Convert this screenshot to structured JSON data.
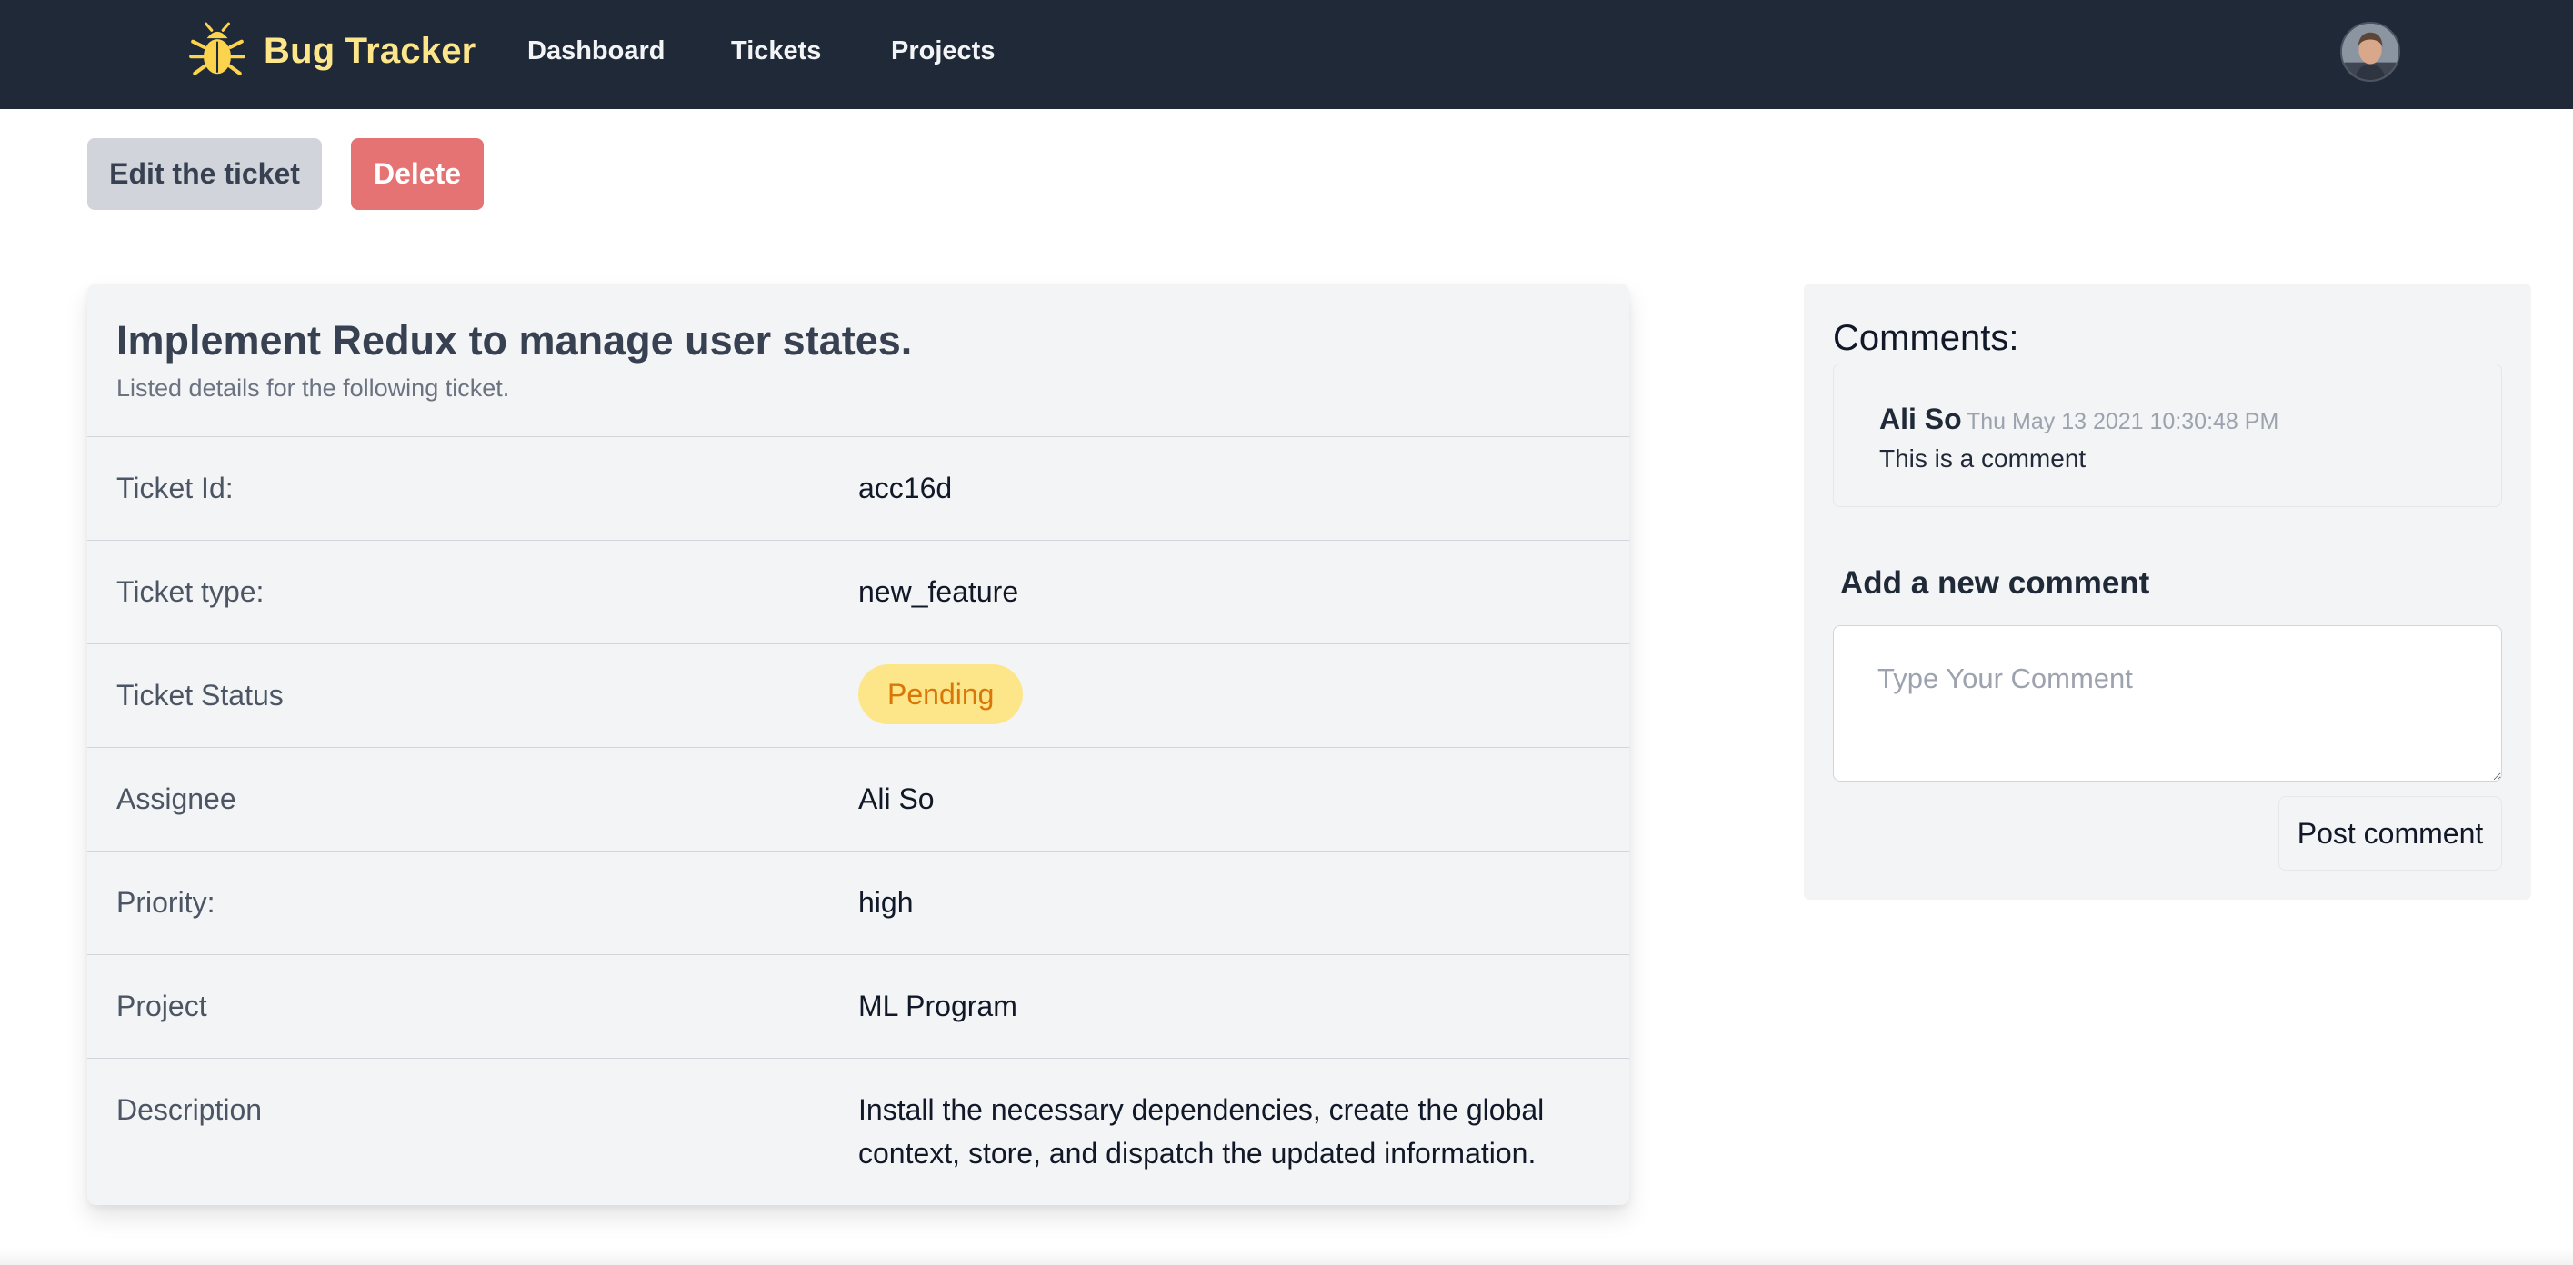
{
  "navbar": {
    "brand": "Bug Tracker",
    "links": [
      "Dashboard",
      "Tickets",
      "Projects"
    ],
    "brand_color": "#fde68a",
    "background_color": "#1f2937",
    "brand_icon": "bug-icon",
    "avatar_icon": "user-avatar"
  },
  "actions": {
    "edit_label": "Edit the ticket",
    "delete_label": "Delete"
  },
  "ticket": {
    "title": "Implement Redux to manage user states.",
    "subtitle": "Listed details for the following ticket.",
    "rows": [
      {
        "label": "Ticket Id:",
        "value": "acc16d"
      },
      {
        "label": "Ticket type:",
        "value": "new_feature"
      },
      {
        "label": "Ticket Status",
        "value": "Pending"
      },
      {
        "label": "Assignee",
        "value": "Ali So"
      },
      {
        "label": "Priority:",
        "value": "high"
      },
      {
        "label": "Project",
        "value": "ML Program"
      },
      {
        "label": "Description",
        "value": "Install the necessary dependencies, create the global context, store, and dispatch the updated information."
      }
    ],
    "status_color": "#d97706",
    "status_bg": "#fde68a"
  },
  "comments": {
    "heading": "Comments:",
    "items": [
      {
        "author": "Ali So",
        "date": "Thu May 13 2021 10:30:48 PM",
        "text": "This is a comment"
      }
    ],
    "add_heading": "Add a new comment",
    "input_placeholder": "Type Your Comment",
    "input_value": "",
    "post_label": "Post comment"
  }
}
